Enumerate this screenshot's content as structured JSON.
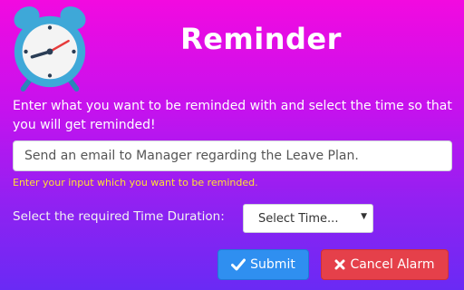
{
  "header": {
    "title": "Reminder"
  },
  "form": {
    "instructions": "Enter what you want to be reminded with and select the time so that you will get reminded!",
    "reminder_value": "Send an email to Manager regarding the Leave Plan.",
    "hint": "Enter your input which you want to be reminded.",
    "duration_label": "Select the required Time Duration:",
    "time_select_value": "Select Time..."
  },
  "buttons": {
    "submit_label": "Submit",
    "cancel_label": "Cancel Alarm"
  },
  "icons": {
    "logo": "alarm-clock-icon",
    "submit": "check-icon",
    "cancel": "times-icon",
    "select_caret": "caret-down-icon"
  },
  "colors": {
    "background_top": "#f20ae0",
    "background_bottom": "#6a2af4",
    "hint": "#ffe033",
    "submit": "#2f8ff0",
    "cancel": "#e5404a"
  }
}
